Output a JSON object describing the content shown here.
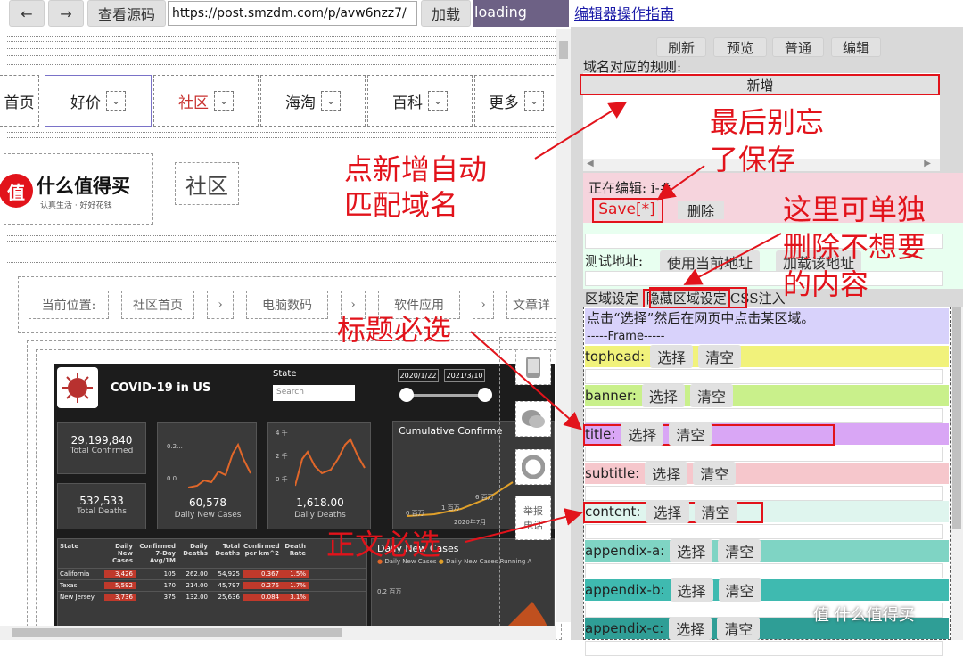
{
  "toolbar": {
    "back_icon": "arrow-left-icon",
    "forward_icon": "arrow-right-icon",
    "view_source": "查看源码",
    "url": "https://post.smzdm.com/p/avw6nzz7/",
    "load": "加载",
    "status": "loading",
    "guide_link": "编辑器操作指南"
  },
  "nav": {
    "items": [
      "首页",
      "好价",
      "社区",
      "海淘",
      "百科",
      "更多"
    ],
    "active_color": "#c8312f"
  },
  "logo": {
    "mark": "值",
    "name": "什么值得买",
    "slogan": "认真生活 · 好好花钱"
  },
  "section_title": "社区",
  "breadcrumb": [
    "当前位置:",
    "社区首页",
    "电脑数码",
    "软件应用",
    "文章详"
  ],
  "dashboard": {
    "title": "COVID-19 in US",
    "state_label": "State",
    "search_placeholder": "Search",
    "date_from": "2020/1/22",
    "date_to": "2021/3/10",
    "cards": [
      {
        "value": "29,199,840",
        "label": "Total Confirmed"
      },
      {
        "value": "532,533",
        "label": "Total Deaths"
      },
      {
        "value": "60,578",
        "label": "Daily New Cases"
      },
      {
        "value": "1,618.00",
        "label": "Daily Deaths"
      }
    ],
    "mini1_ticks": [
      "0.2...",
      "0.0..."
    ],
    "mini2_ticks": [
      "4 千",
      "2 千",
      "0 千"
    ],
    "cumulative_title": "Cumulative Confirme",
    "cumulative_labels": [
      "6 百万",
      "1 百万",
      "0 百万",
      "2020年7月"
    ],
    "table_headers": [
      "State",
      "Daily New Cases",
      "Confirmed 7-Day Avg/1M",
      "Daily Deaths",
      "Total Deaths",
      "Confirmed per km^2",
      "Death Rate"
    ],
    "table_rows": [
      [
        "California",
        "3,426",
        "105",
        "262.00",
        "54,925",
        "0.367",
        "1.5%"
      ],
      [
        "Texas",
        "5,592",
        "170",
        "214.00",
        "45,797",
        "0.276",
        "1.7%"
      ],
      [
        "New Jersey",
        "3,736",
        "375",
        "132.00",
        "25,636",
        "0.084",
        "3.1%"
      ]
    ],
    "daily_title": "Daily New Cases",
    "daily_legend": [
      "Daily New Cases",
      "Daily New Cases Running A"
    ],
    "daily_tick": "0.2 百万"
  },
  "side_icons": [
    "phone-icon",
    "wechat-icon",
    "lifebuoy-icon"
  ],
  "side_report": "举报\n电话",
  "panel": {
    "top_buttons": [
      "刷新",
      "预览",
      "普通",
      "编辑"
    ],
    "rule_label": "域名对应的规则:",
    "add_button": "新增",
    "editing": "正在编辑: i-#",
    "save": "Save[*]",
    "delete": "删除",
    "test_label": "测试地址:",
    "use_current": "使用当前地址",
    "load_addr": "加载该地址",
    "tabs": [
      "区域设定",
      "隐藏区域设定",
      "CSS注入"
    ],
    "hint": "点击“选择”然后在网页中点击某区域。",
    "frame": "-----Frame-----",
    "select": "选择",
    "clear": "清空",
    "fields": [
      {
        "name": "tophead:",
        "color": "#f1f27b"
      },
      {
        "name": "banner:",
        "color": "#c9f08b"
      },
      {
        "name": "title:",
        "color": "#d9a6f5"
      },
      {
        "name": "subtitle:",
        "color": "#f6c7cc"
      },
      {
        "name": "content:",
        "color": "#dff5ee"
      },
      {
        "name": "appendix-a:",
        "color": "#7fd4c4"
      },
      {
        "name": "appendix-b:",
        "color": "#3fbab0"
      },
      {
        "name": "appendix-c:",
        "color": "#2f9e96"
      }
    ]
  },
  "annotations": {
    "a1": "点新增自动\n匹配域名",
    "a2": "最后别忘\n了保存",
    "a3": "这里可单独\n删除不想要\n的内容",
    "a4": "标题必选",
    "a5": "正文必选"
  },
  "watermark": "值 什么值得买",
  "colors": {
    "annotation": "#e2131b",
    "status_bg": "#6d6185",
    "editing_bg": "#f6d4dd"
  }
}
